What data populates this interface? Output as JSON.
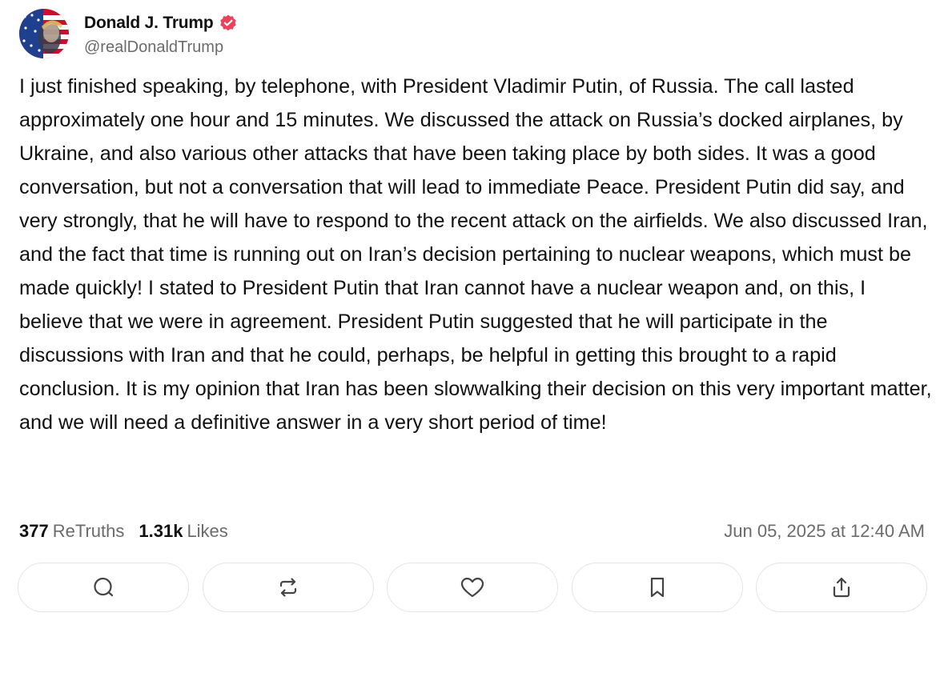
{
  "author": {
    "display_name": "Donald J. Trump",
    "handle": "@realDonaldTrump",
    "verified": true,
    "avatar_icon": "profile-photo",
    "verified_icon": "verified-badge-icon",
    "verified_color": "#e8435b"
  },
  "post": {
    "text": "I just finished speaking, by telephone, with President Vladimir Putin, of Russia. The call lasted approximately one hour and 15 minutes. We discussed the attack on Russia’s docked airplanes, by Ukraine, and also various other attacks that have been taking place by both sides. It was a good conversation, but not a conversation that will lead to immediate Peace. President Putin did say, and very strongly, that he will have to respond to the recent attack on the airfields. We also discussed Iran, and the fact that time is running out on Iran’s decision pertaining to nuclear weapons, which must be made quickly! I stated to President Putin that Iran cannot have a nuclear weapon and, on this, I believe that we were in agreement. President Putin suggested that he will participate in the discussions with Iran and that he could, perhaps, be helpful in getting this brought to a rapid conclusion. It is my opinion that Iran has been slowwalking their decision on this very important matter, and we will need a definitive answer in a very short period of time!"
  },
  "stats": {
    "retruths_count": "377",
    "retruths_label": "ReTruths",
    "likes_count": "1.31k",
    "likes_label": "Likes",
    "timestamp": "Jun 05, 2025 at 12:40 AM"
  },
  "actions": [
    {
      "icon": "reply-icon"
    },
    {
      "icon": "retruth-icon"
    },
    {
      "icon": "like-heart-icon"
    },
    {
      "icon": "bookmark-icon"
    },
    {
      "icon": "share-icon"
    }
  ],
  "colors": {
    "text": "#111111",
    "muted": "#6b6b6b",
    "border": "#e4e4e7",
    "icon": "#444444"
  }
}
